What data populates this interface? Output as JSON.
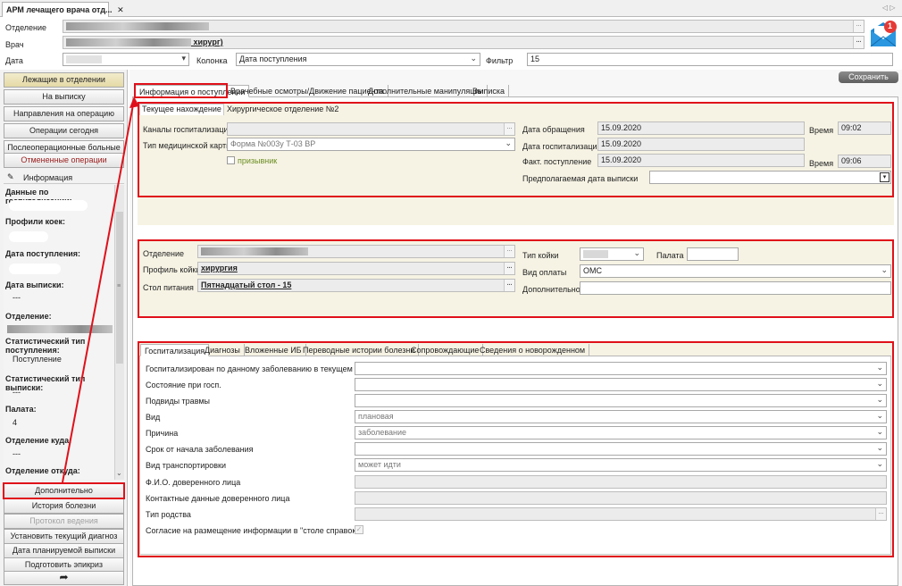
{
  "window": {
    "tab_title": "АРМ лечащего врача отд...",
    "tab_close": "✕",
    "nav_arrows": "◁ ▷"
  },
  "filters": {
    "department_label": "Отделение",
    "doctor_label": "Врач",
    "doctor_value": "хирург)",
    "date_label": "Дата",
    "column_label": "Колонка",
    "column_value": "Дата поступления",
    "filter_label": "Фильтр",
    "filter_value": "15"
  },
  "notification_count": "1",
  "sidebar": {
    "top_buttons": [
      "Лежащие в отделении",
      "На выписку",
      "Направления на операцию",
      "Операции сегодня",
      "Послеоперационные больные",
      "Отмененные операции"
    ],
    "info_header": "Информация",
    "info": {
      "hosp_data": "Данные по госпитализации:",
      "bed_profiles": "Профили коек:",
      "admission_date": "Дата поступления:",
      "discharge_date": "Дата выписки:",
      "discharge_value": "---",
      "department": "Отделение:",
      "stat_admission": "Статистический тип поступления:",
      "stat_admission_value": "Поступление",
      "stat_discharge": "Статистический тип выписки:",
      "stat_discharge_value": "---",
      "ward": "Палата:",
      "ward_value": "4",
      "dept_to": "Отделение куда:",
      "dept_to_value": "---",
      "dept_from": "Отделение откуда:"
    },
    "bottom_buttons": [
      "Дополнительно",
      "История болезни",
      "Протокол ведения",
      "Установить текущий диагноз",
      "Дата планируемой выписки",
      "Подготовить эпикриз"
    ]
  },
  "save_button": "Сохранить",
  "main_tabs": [
    "Информация о поступлении",
    "Врачебные осмотры/Движение пациента",
    "Дополнительные манипуляции",
    "Выписка"
  ],
  "section1": {
    "current_location_label": "Текущее нахождение",
    "current_location_value": "Хирургическое отделение №2",
    "hosp_channels_label": "Каналы госпитализации",
    "card_type_label": "Тип медицинской карты",
    "card_type_value": "Форма №003у Т-03 ВР",
    "conscript_label": "призывник",
    "appeal_date_label": "Дата обращения",
    "appeal_date_value": "15.09.2020",
    "time_label": "Время",
    "appeal_time_value": "09:02",
    "hosp_date_label": "Дата госпитализации",
    "hosp_date_value": "15.09.2020",
    "actual_admission_label": "Факт. поступление",
    "actual_admission_value": "15.09.2020",
    "actual_time_value": "09:06",
    "expected_discharge_label": "Предполагаемая дата выписки"
  },
  "section2": {
    "department_label": "Отделение",
    "bed_profile_label": "Профиль койки",
    "bed_profile_value": "хирургия",
    "diet_label": "Стол питания",
    "diet_value": "Пятнадцатый стол - 15",
    "bed_type_label": "Тип койки",
    "ward_label": "Палата",
    "payment_label": "Вид оплаты",
    "payment_value": "ОМС",
    "additional_label": "Дополнительно"
  },
  "sub_tabs": [
    "Госпитализация",
    "Диагнозы",
    "Вложенные ИБ",
    "Переводные истории болезни",
    "Сопровождающие",
    "Сведения о новорожденном"
  ],
  "hosp_form": [
    {
      "label": "Госпитализирован по данному заболеванию в текущем году",
      "value": "",
      "kind": "select"
    },
    {
      "label": "Состояние при госп.",
      "value": "",
      "kind": "select"
    },
    {
      "label": "Подвиды травмы",
      "value": "",
      "kind": "select"
    },
    {
      "label": "Вид",
      "value": "плановая",
      "kind": "select"
    },
    {
      "label": "Причина",
      "value": "заболевание",
      "kind": "select"
    },
    {
      "label": "Срок от начала заболевания",
      "value": "",
      "kind": "select"
    },
    {
      "label": "Вид транспортировки",
      "value": "может идти",
      "kind": "select"
    },
    {
      "label": "Ф.И.О. доверенного лица",
      "value": "",
      "kind": "text"
    },
    {
      "label": "Контактные данные доверенного лица",
      "value": "",
      "kind": "text"
    },
    {
      "label": "Тип родства",
      "value": "",
      "kind": "lookup"
    },
    {
      "label": "Согласие на размещение информации в \"столе справок\"",
      "value": "",
      "kind": "check"
    }
  ]
}
